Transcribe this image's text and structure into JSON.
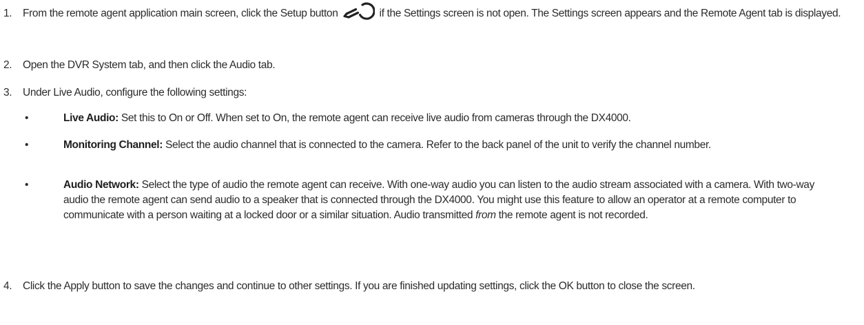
{
  "steps": [
    {
      "number": "1.",
      "before_icon": "From the remote agent application main screen, click the Setup button",
      "icon": "setup-wrench-icon",
      "after_icon": "if the Settings screen is not open. The Settings screen appears and the Remote Agent tab is displayed."
    },
    {
      "number": "2.",
      "text": "Open the DVR System tab, and then click the Audio tab."
    },
    {
      "number": "3.",
      "text": "Under Live Audio, configure the following settings:",
      "bullets": [
        {
          "marker": "•",
          "term": "Live Audio:",
          "text": " Set this to On or Off. When set to On, the remote agent can receive live audio from cameras through the DX4000."
        },
        {
          "marker": "•",
          "term": "Monitoring Channel:",
          "text": " Select the audio channel that is connected to the camera. Refer to the back panel of the unit to verify the channel number."
        },
        {
          "marker": "•",
          "term": "Audio Network:",
          "text_before_emphasis": " Select the type of audio the remote agent can receive. With one-way audio you can listen to the audio stream associated with a camera. With two-way audio the remote agent can send audio to a speaker that is connected through the DX4000. You might use this feature to allow an operator at a remote computer to communicate with a person waiting at a locked door or a similar situation. Audio transmitted ",
          "emphasis": "from",
          "text_after_emphasis": " the remote agent is not recorded."
        }
      ]
    },
    {
      "number": "4.",
      "text": "Click the Apply button to save the changes and continue to other settings. If you are finished updating settings, click the OK button to close the screen."
    }
  ]
}
